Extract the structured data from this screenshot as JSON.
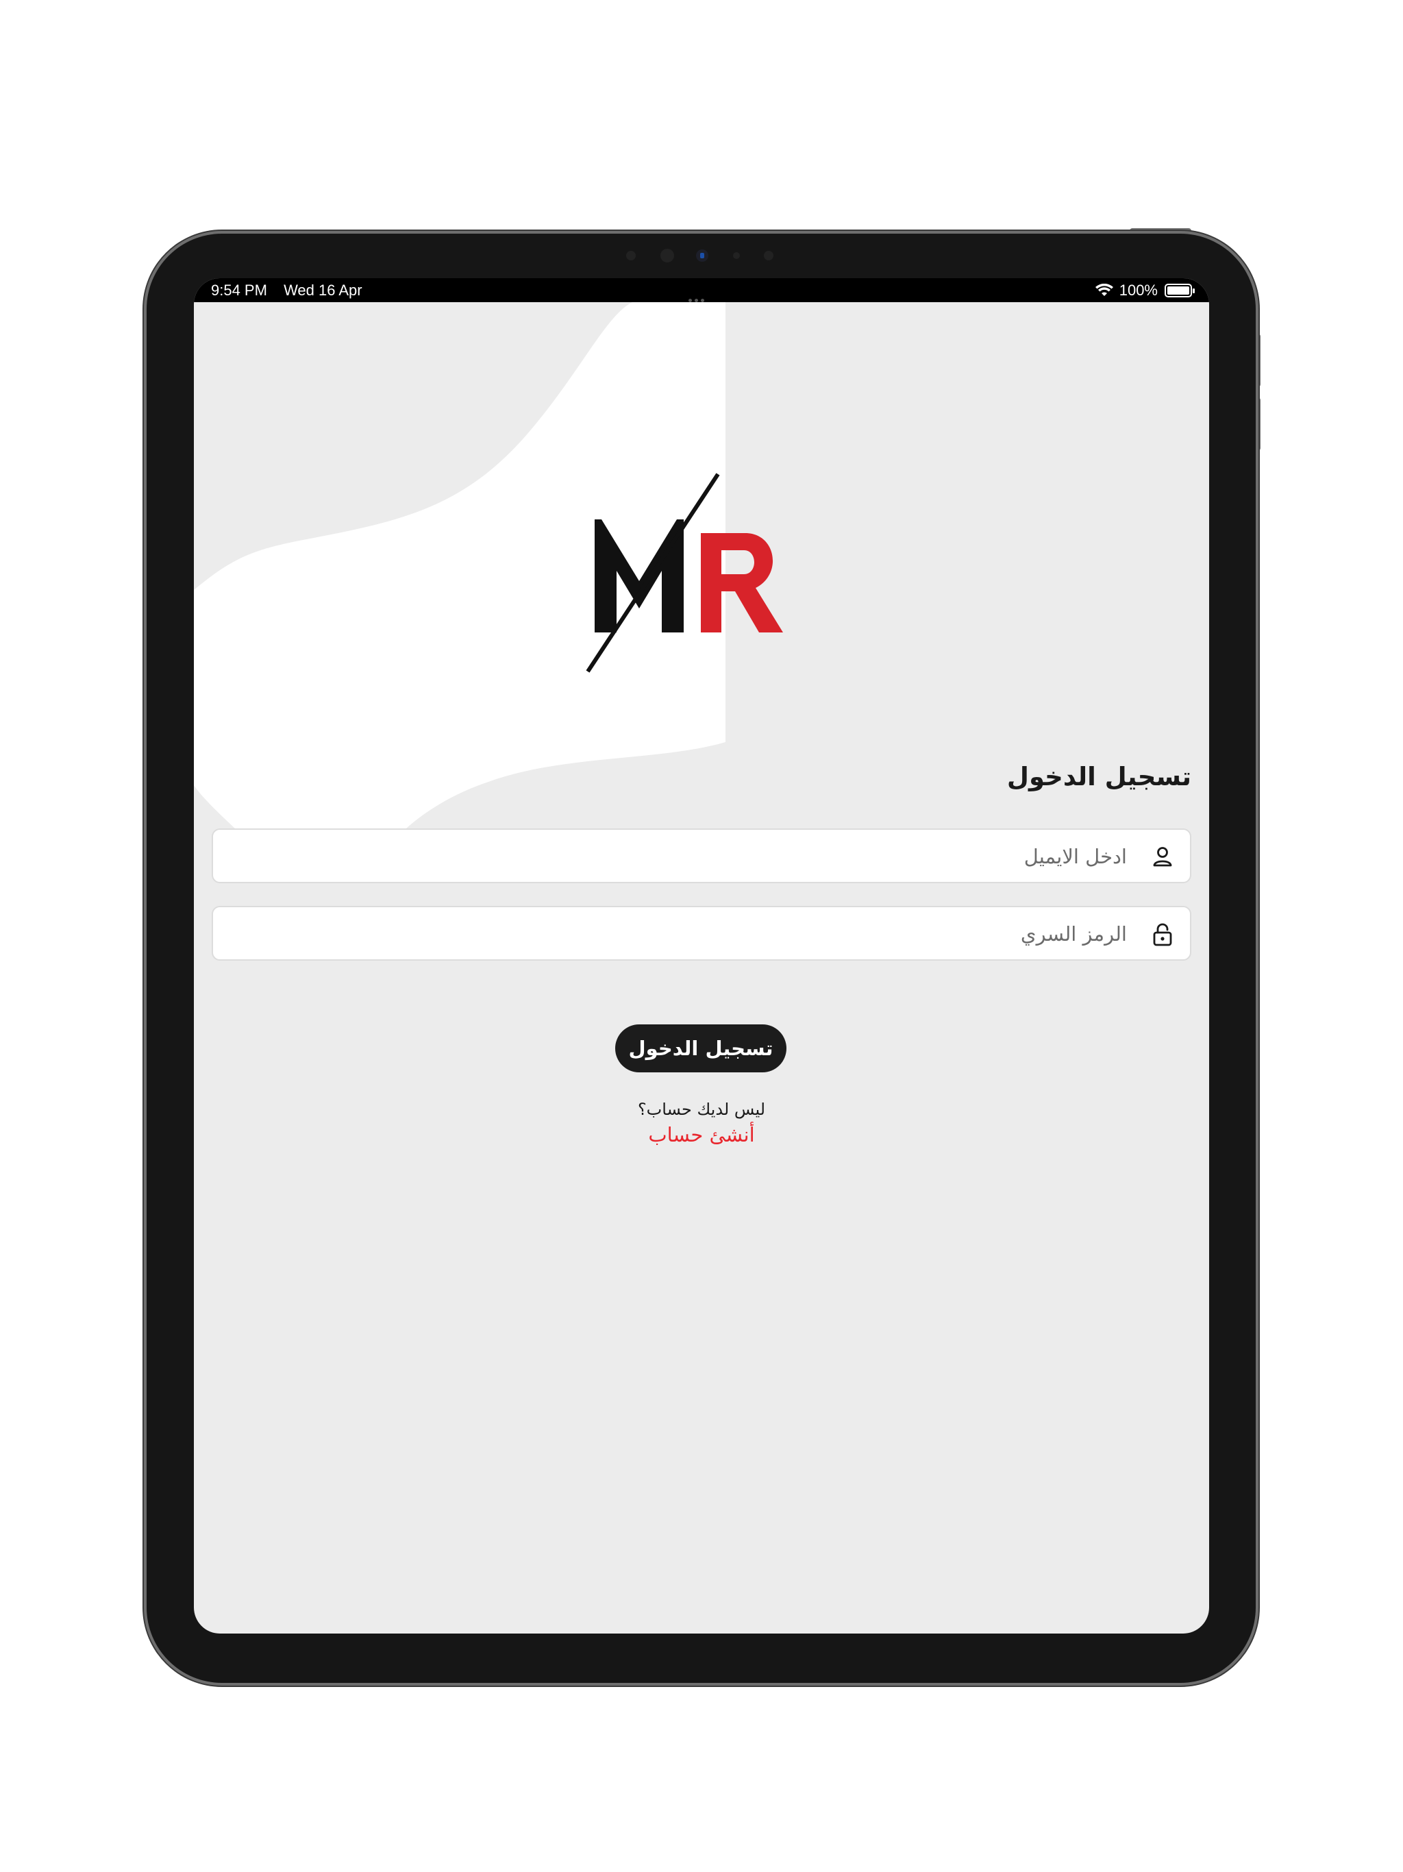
{
  "status_bar": {
    "time": "9:54 PM",
    "date": "Wed 16 Apr",
    "battery": "100%",
    "icons": [
      "wifi-icon",
      "battery-icon"
    ]
  },
  "logo": {
    "text": "MR",
    "colors": {
      "m": "#111111",
      "r": "#d8232a",
      "slash": "#111111"
    }
  },
  "login": {
    "title": "تسجيل الدخول",
    "email_placeholder": "ادخل الايميل",
    "email_value": "",
    "password_placeholder": "الرمز السري",
    "password_value": "",
    "submit_label": "تسجيل الدخول",
    "no_account_text": "ليس لديك حساب؟",
    "create_account_link": "أنشئ حساب",
    "icons": [
      "person-icon",
      "lock-icon"
    ]
  },
  "theme": {
    "background": "#ececec",
    "accent": "#e8262d",
    "button": "#1c1c1c"
  }
}
